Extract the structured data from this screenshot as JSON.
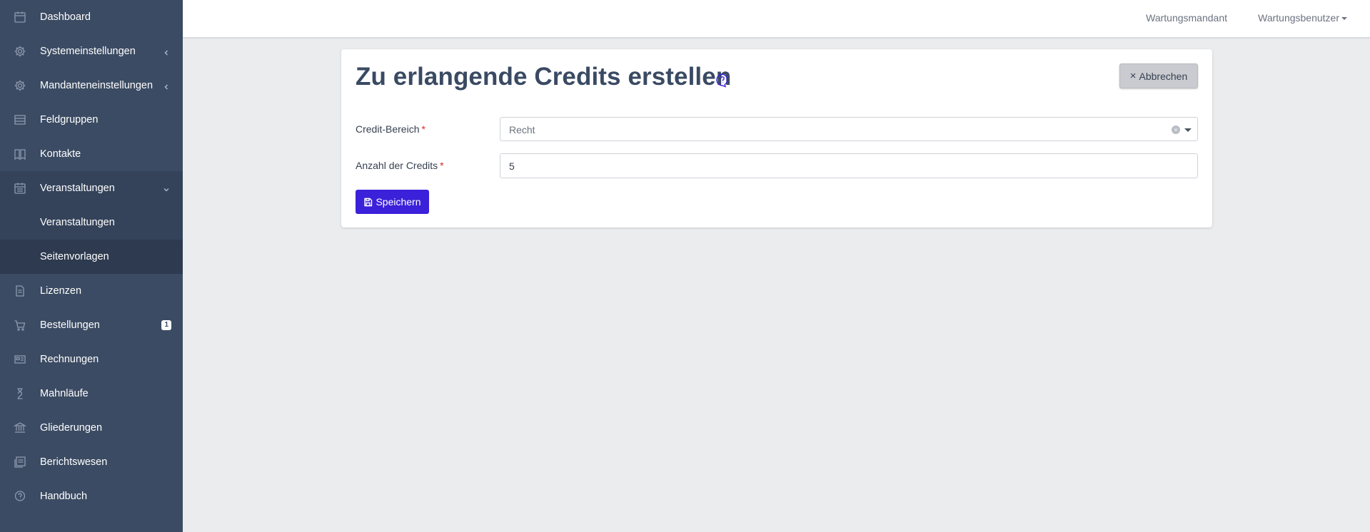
{
  "sidebar": {
    "items": [
      {
        "label": "Dashboard",
        "icon": "calendar-icon"
      },
      {
        "label": "Systemeinstellungen",
        "icon": "gear-icon"
      },
      {
        "label": "Mandanteneinstellungen",
        "icon": "gear-icon"
      },
      {
        "label": "Feldgruppen",
        "icon": "list-icon"
      },
      {
        "label": "Kontakte",
        "icon": "address-book-icon"
      },
      {
        "label": "Veranstaltungen",
        "icon": "calendar-icon"
      },
      {
        "label": "Lizenzen",
        "icon": "document-icon"
      },
      {
        "label": "Bestellungen",
        "icon": "cart-icon",
        "badge": "1"
      },
      {
        "label": "Rechnungen",
        "icon": "invoice-icon"
      },
      {
        "label": "Mahnläufe",
        "icon": "hourglass-icon"
      },
      {
        "label": "Gliederungen",
        "icon": "bank-icon"
      },
      {
        "label": "Berichtswesen",
        "icon": "reports-icon"
      },
      {
        "label": "Handbuch",
        "icon": "help-chat-icon"
      }
    ],
    "subitems": [
      {
        "label": "Veranstaltungen"
      },
      {
        "label": "Seitenvorlagen"
      }
    ]
  },
  "topbar": {
    "tenant": "Wartungsmandant",
    "user": "Wartungsbenutzer"
  },
  "page": {
    "title": "Zu erlangende Credits erstellen",
    "cancel_label": "Abbrechen",
    "save_label": "Speichern"
  },
  "form": {
    "area_label": "Credit-Bereich",
    "area_value": "Recht",
    "count_label": "Anzahl der Credits",
    "count_value": "5",
    "required_mark": "*"
  },
  "colors": {
    "sidebar_bg": "#3b4b63",
    "accent": "#3b21d9",
    "page_bg": "#ebecee"
  }
}
